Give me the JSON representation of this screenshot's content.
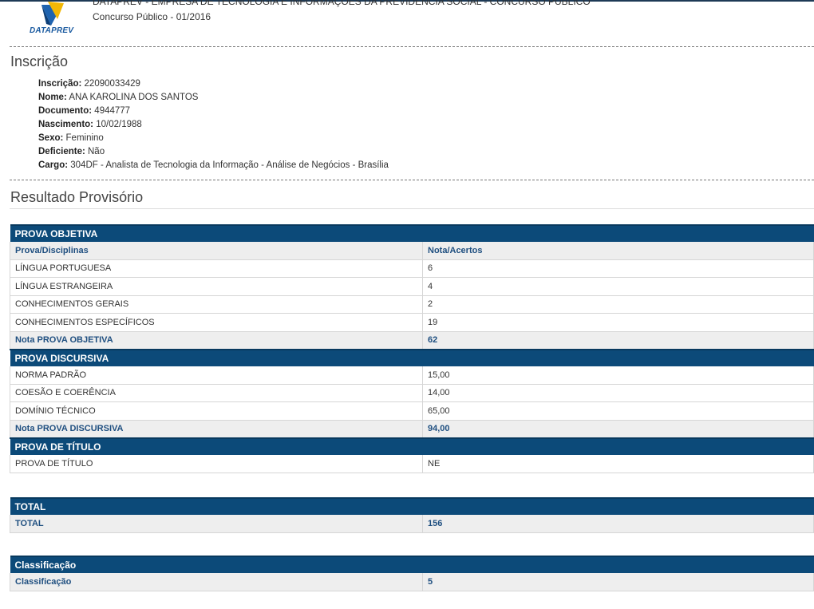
{
  "header": {
    "logo_text": "DATAPREV",
    "org_title": "DATAPREV - EMPRESA DE TECNOLOGIA E INFORMAÇÕES DA PREVIDÊNCIA SOCIAL - CONCURSO PÚBLICO",
    "subtitle": "Concurso Público - 01/2016"
  },
  "inscricao": {
    "title": "Inscrição",
    "fields": [
      {
        "label": "Inscrição:",
        "value": "22090033429"
      },
      {
        "label": "Nome:",
        "value": "ANA KAROLINA DOS SANTOS"
      },
      {
        "label": "Documento:",
        "value": "4944777"
      },
      {
        "label": "Nascimento:",
        "value": "10/02/1988"
      },
      {
        "label": "Sexo:",
        "value": "Feminino"
      },
      {
        "label": "Deficiente:",
        "value": "Não"
      },
      {
        "label": "Cargo:",
        "value": "304DF - Analista de Tecnologia da Informação - Análise de Negócios - Brasília"
      }
    ]
  },
  "resultado": {
    "title": "Resultado Provisório",
    "objetiva": {
      "header": "PROVA OBJETIVA",
      "col1": "Prova/Disciplinas",
      "col2": "Nota/Acertos",
      "rows": [
        {
          "name": "LÍNGUA PORTUGUESA",
          "value": "6"
        },
        {
          "name": "LÍNGUA ESTRANGEIRA",
          "value": "4"
        },
        {
          "name": "CONHECIMENTOS GERAIS",
          "value": "2"
        },
        {
          "name": "CONHECIMENTOS ESPECÍFICOS",
          "value": "19"
        }
      ],
      "total_label": "Nota PROVA OBJETIVA",
      "total_value": "62"
    },
    "discursiva": {
      "header": "PROVA DISCURSIVA",
      "rows": [
        {
          "name": "NORMA PADRÃO",
          "value": "15,00"
        },
        {
          "name": "COESÃO E COERÊNCIA",
          "value": "14,00"
        },
        {
          "name": "DOMÍNIO TÉCNICO",
          "value": "65,00"
        }
      ],
      "total_label": "Nota PROVA DISCURSIVA",
      "total_value": "94,00"
    },
    "titulo": {
      "header": "PROVA DE TÍTULO",
      "rows": [
        {
          "name": "PROVA DE TÍTULO",
          "value": "NE"
        }
      ]
    },
    "total": {
      "header": "TOTAL",
      "label": "TOTAL",
      "value": "156"
    },
    "classificacao": {
      "header": "Classificação",
      "label": "Classificação",
      "value": "5"
    }
  }
}
